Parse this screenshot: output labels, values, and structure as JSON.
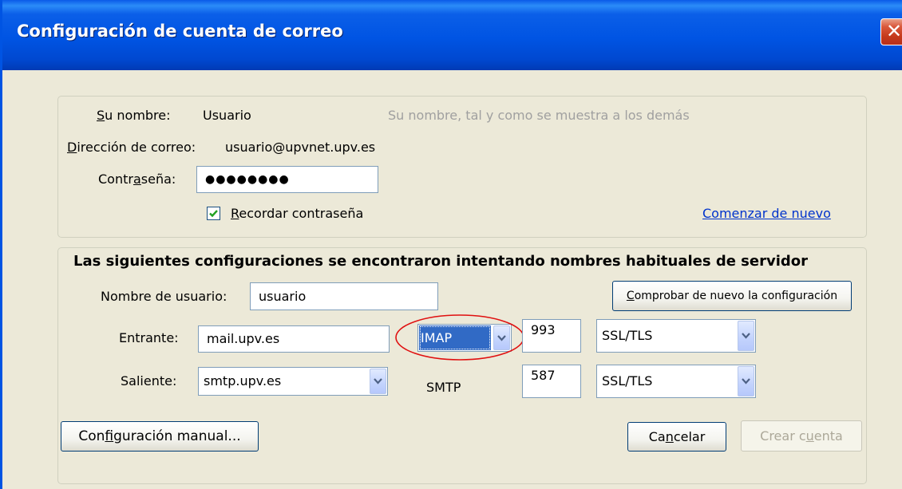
{
  "window": {
    "title": "Configuración de cuenta de correo",
    "close_glyph": "✕"
  },
  "identity": {
    "name_label_pre": "",
    "name_label_accel": "S",
    "name_label_post": "u nombre:",
    "name_value": "Usuario",
    "name_hint": "Su nombre, tal y como se muestra a los demás",
    "email_label_accel": "D",
    "email_label_post": "irección de correo:",
    "email_value": "usuario@upvnet.upv.es",
    "password_label_pre": "Contr",
    "password_label_accel": "a",
    "password_label_post": "seña:",
    "password_value": "●●●●●●●●",
    "remember_checked": true,
    "remember_label_accel": "R",
    "remember_label_post": "ecordar contraseña",
    "start_over_link": "Comenzar de nuevo"
  },
  "servers": {
    "heading": "Las siguientes configuraciones se encontraron intentando nombres habituales de servidor",
    "username_label": "Nombre de usuario:",
    "username_value": "usuario",
    "recheck_button_accel": "C",
    "recheck_button_post": "omprobar de nuevo la configuración",
    "incoming_label": "Entrante:",
    "incoming_host": "mail.upv.es",
    "incoming_protocol": "IMAP",
    "incoming_port": "993",
    "incoming_security": "SSL/TLS",
    "outgoing_label": "Saliente:",
    "outgoing_host": "smtp.upv.es",
    "outgoing_protocol": "SMTP",
    "outgoing_port": "587",
    "outgoing_security": "SSL/TLS"
  },
  "footer": {
    "manual_pre": "Con",
    "manual_accel": "f",
    "manual_post": "iguración manual...",
    "cancel_pre": "Ca",
    "cancel_accel": "n",
    "cancel_post": "celar",
    "create_pre": "Crear c",
    "create_accel": "u",
    "create_post": "enta"
  },
  "colors": {
    "titlebar": "#0054e3",
    "highlight_ellipse": "#e01010",
    "selection": "#316ac5",
    "link": "#0033cc"
  }
}
